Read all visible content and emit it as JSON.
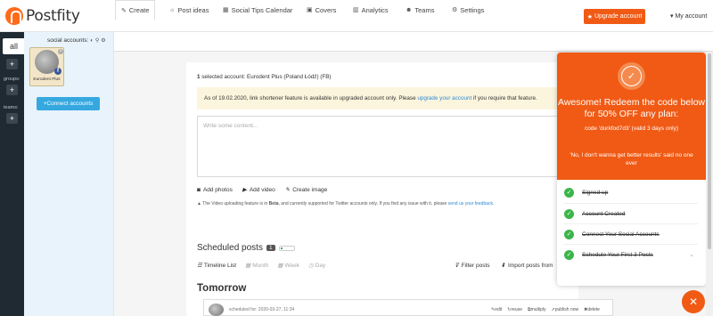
{
  "app": {
    "name": "Postfity"
  },
  "header": {
    "upgrade_label": "Upgrade account",
    "account_label": "My account"
  },
  "rail": {
    "all_label": "all",
    "groups_label": "groups:",
    "teams_label": "teams:",
    "plus": "+"
  },
  "accounts": {
    "heading": "social accounts:",
    "items": [
      {
        "name": "Eurodent Plus",
        "network": "f"
      }
    ],
    "connect_label": "Connect accounts"
  },
  "tabs": [
    {
      "label": "Create",
      "icon": "pencil-icon"
    },
    {
      "label": "Post ideas",
      "icon": "lightbulb-icon"
    },
    {
      "label": "Social Tips Calendar",
      "icon": "calendar-icon"
    },
    {
      "label": "Covers",
      "icon": "image-icon"
    },
    {
      "label": "Analytics",
      "icon": "bar-chart-icon"
    },
    {
      "label": "Teams",
      "icon": "users-icon"
    },
    {
      "label": "Settings",
      "icon": "gears-icon"
    }
  ],
  "compose": {
    "selected_count": "1",
    "selected_text": "selected account:",
    "selected_name": "Eurodent Plus (Poland Łódź) (FB)",
    "notice_before": "As of 19.02.2020, link shortener feature is available in upgraded account only. Please",
    "notice_link": "upgrade your account",
    "notice_after": "if you require that feature.",
    "placeholder": "Write some content...",
    "add_photos": "Add photos",
    "add_video": "Add video",
    "create_image": "Create image",
    "beta_before": "The Video uploading feature is in",
    "beta_bold": "Beta",
    "beta_mid": ", and currently supported for Twitter accounts only. If you find any issue with it, please",
    "beta_link": "send us your feedback",
    "beta_after": "."
  },
  "scheduled": {
    "title": "Scheduled posts",
    "count": "1",
    "views": [
      "Timeline List",
      "Month",
      "Week",
      "Day"
    ],
    "filter_label": "Filter posts",
    "import_label": "Import posts from",
    "day_heading": "Tomorrow",
    "post": {
      "time": "scheduled for: 2020-03-27, 11:34",
      "actions": [
        "edit",
        "reuse",
        "multiply",
        "publish now",
        "delete"
      ]
    }
  },
  "promo": {
    "headline": "Awesome! Redeem the code below for 50% OFF any plan:",
    "code_text": "code 'durkfod7d3' (valid 3 days only)",
    "decline_text": "'No, I don't wanna get better results'  said no one ever",
    "checklist": [
      "Signed up",
      "Account Created",
      "Connect Your Social Accounts",
      "Schedule Your First 3 Posts"
    ]
  },
  "colors": {
    "brand": "#f05a14",
    "link": "#2b8ad6",
    "success": "#3bb54a",
    "connect": "#35a8e0"
  }
}
